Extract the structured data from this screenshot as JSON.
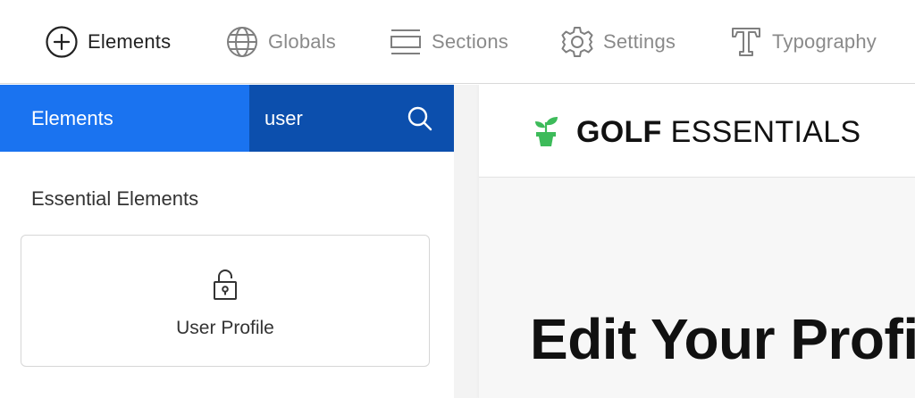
{
  "toolbar": {
    "tabs": [
      {
        "label": "Elements",
        "icon": "plus-circle-icon",
        "active": true
      },
      {
        "label": "Globals",
        "icon": "globe-icon",
        "active": false
      },
      {
        "label": "Sections",
        "icon": "sections-icon",
        "active": false
      },
      {
        "label": "Settings",
        "icon": "gear-icon",
        "active": false
      },
      {
        "label": "Typography",
        "icon": "typography-icon",
        "active": false
      }
    ]
  },
  "panel": {
    "title": "Elements",
    "search": {
      "value": "user",
      "icon": "search-icon"
    },
    "section_label": "Essential Elements",
    "cards": [
      {
        "label": "User Profile",
        "icon": "padlock-icon"
      }
    ]
  },
  "preview": {
    "logo": {
      "bold": "GOLF",
      "light": "ESSENTIALS",
      "icon": "plant-pot-icon"
    },
    "heading": "Edit Your Profile"
  },
  "colors": {
    "accent": "#1a73f0",
    "accent_dark": "#0c4fad",
    "logo_green": "#3dbb5a",
    "text": "#222222",
    "muted": "#8a8a8a"
  }
}
